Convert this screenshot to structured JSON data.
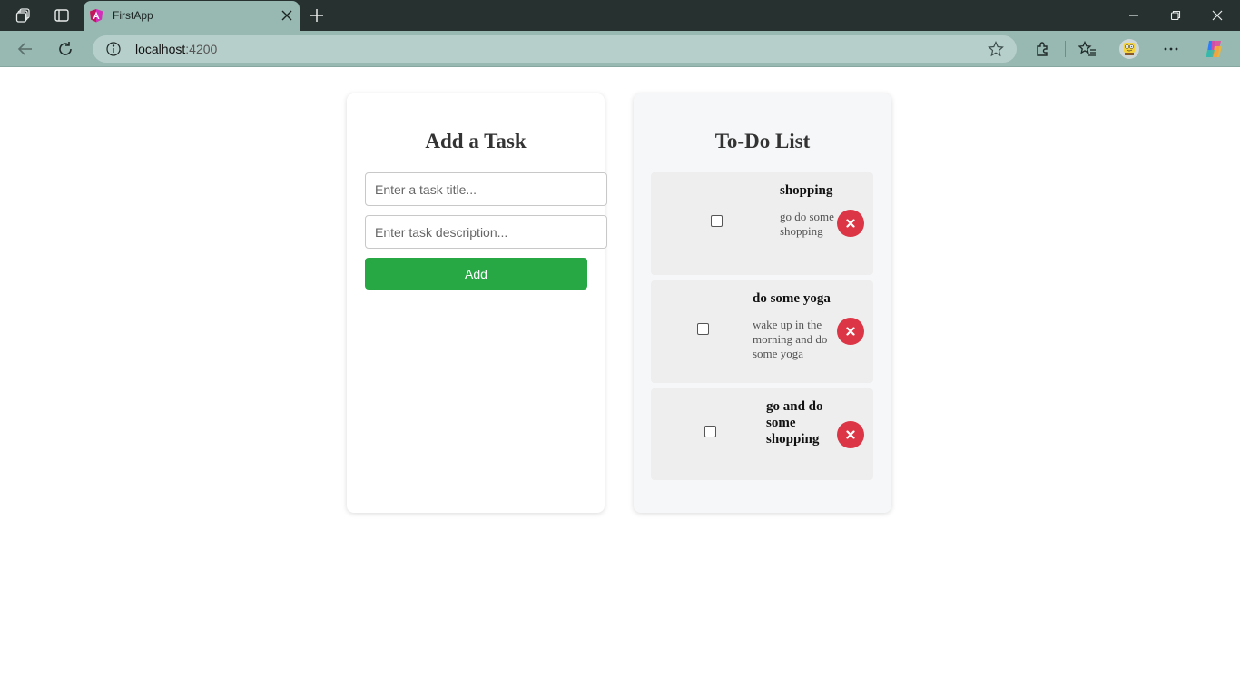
{
  "browser": {
    "tab_title": "FirstApp",
    "url_host": "localhost",
    "url_port": ":4200"
  },
  "add_panel": {
    "heading": "Add a Task",
    "title_placeholder": "Enter a task title...",
    "description_placeholder": "Enter task description...",
    "add_label": "Add"
  },
  "todo_panel": {
    "heading": "To-Do List",
    "items": [
      {
        "title": "shopping",
        "description": "go do some shopping",
        "checked": false
      },
      {
        "title": "do some yoga",
        "description": "wake up in the morning and do some yoga",
        "checked": false
      },
      {
        "title": "go and do some shopping",
        "description": "",
        "checked": false
      }
    ]
  },
  "colors": {
    "add_button": "#28a745",
    "delete_button": "#dc3545",
    "browser_frame": "#98b8b2",
    "titlebar": "#263130"
  },
  "icons": [
    "workspaces-icon",
    "tab-actions-icon",
    "angular-icon",
    "close-tab-icon",
    "new-tab-icon",
    "minimize-icon",
    "restore-icon",
    "close-window-icon",
    "back-icon",
    "reload-icon",
    "site-info-icon",
    "favorite-star-icon",
    "extensions-icon",
    "favorites-icon",
    "profile-avatar-icon",
    "more-icon",
    "copilot-icon",
    "delete-x-icon"
  ]
}
